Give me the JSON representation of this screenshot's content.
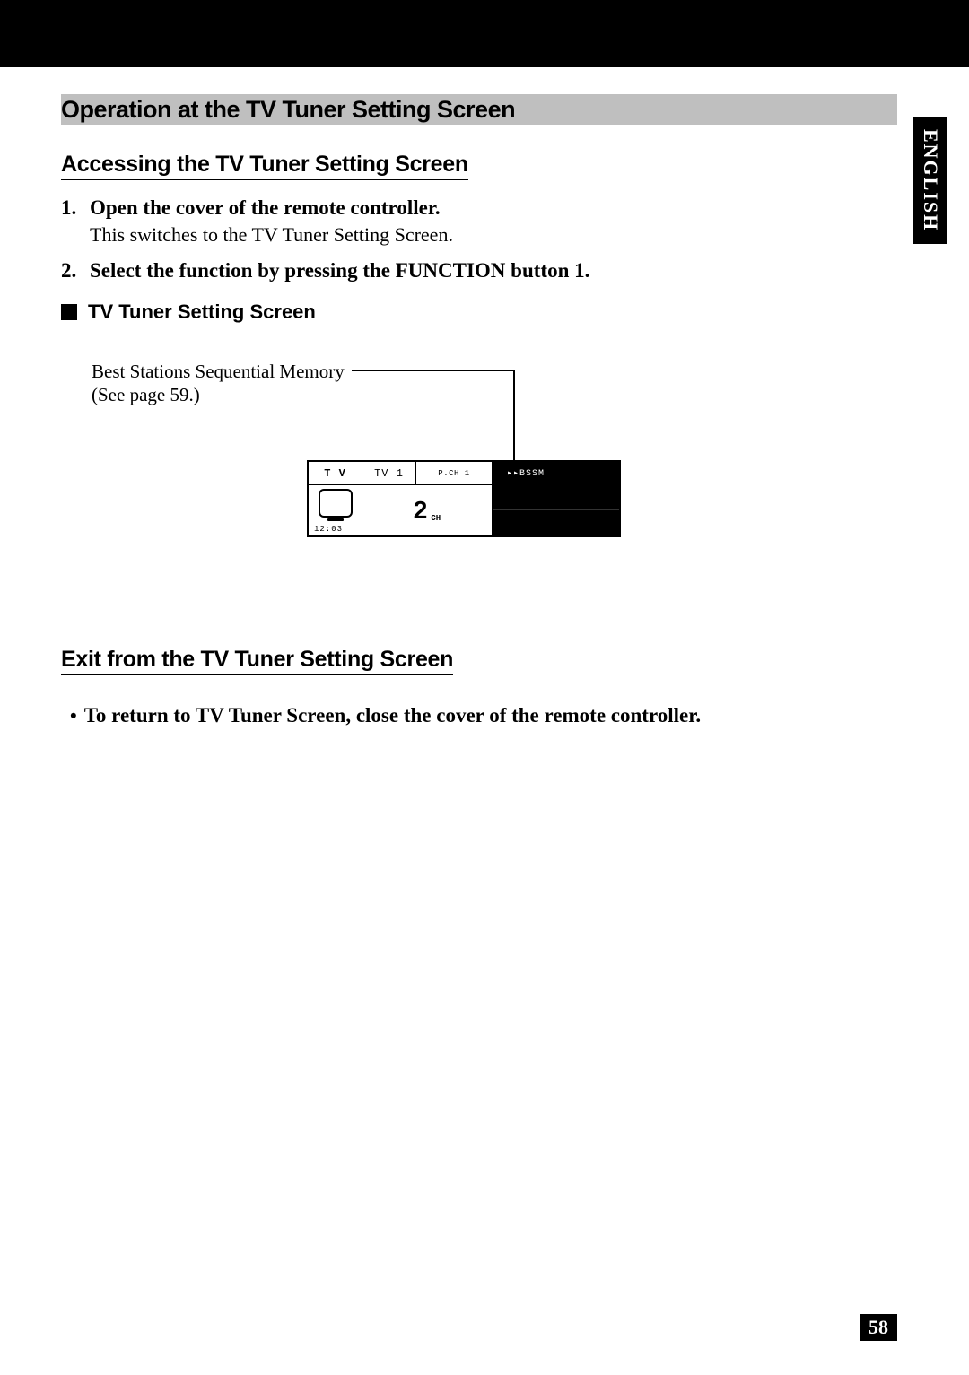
{
  "sideTab": "ENGLISH",
  "pageNumber": "58",
  "sectionTitle": "Operation at the TV Tuner Setting Screen",
  "accessing": {
    "heading": "Accessing the TV Tuner Setting Screen",
    "step1_num": "1.",
    "step1_title": "Open the cover of the remote controller.",
    "step1_body": "This switches to the TV Tuner Setting Screen.",
    "step2_num": "2.",
    "step2_title": "Select the function by pressing the FUNCTION button 1."
  },
  "tvTunerHeading": "TV Tuner Setting Screen",
  "callout": {
    "line1": "Best Stations Sequential Memory",
    "line2": "(See page 59.)"
  },
  "screen": {
    "tv": "T V",
    "tv1": "TV 1",
    "pch": "P.CH 1",
    "bssm": "▸▸BSSM",
    "channelNum": "2",
    "channelUnit": "CH",
    "time": "12:03"
  },
  "exit": {
    "heading": "Exit from the TV Tuner Setting Screen",
    "bullet": "To return to TV Tuner Screen, close the cover of the remote controller."
  }
}
